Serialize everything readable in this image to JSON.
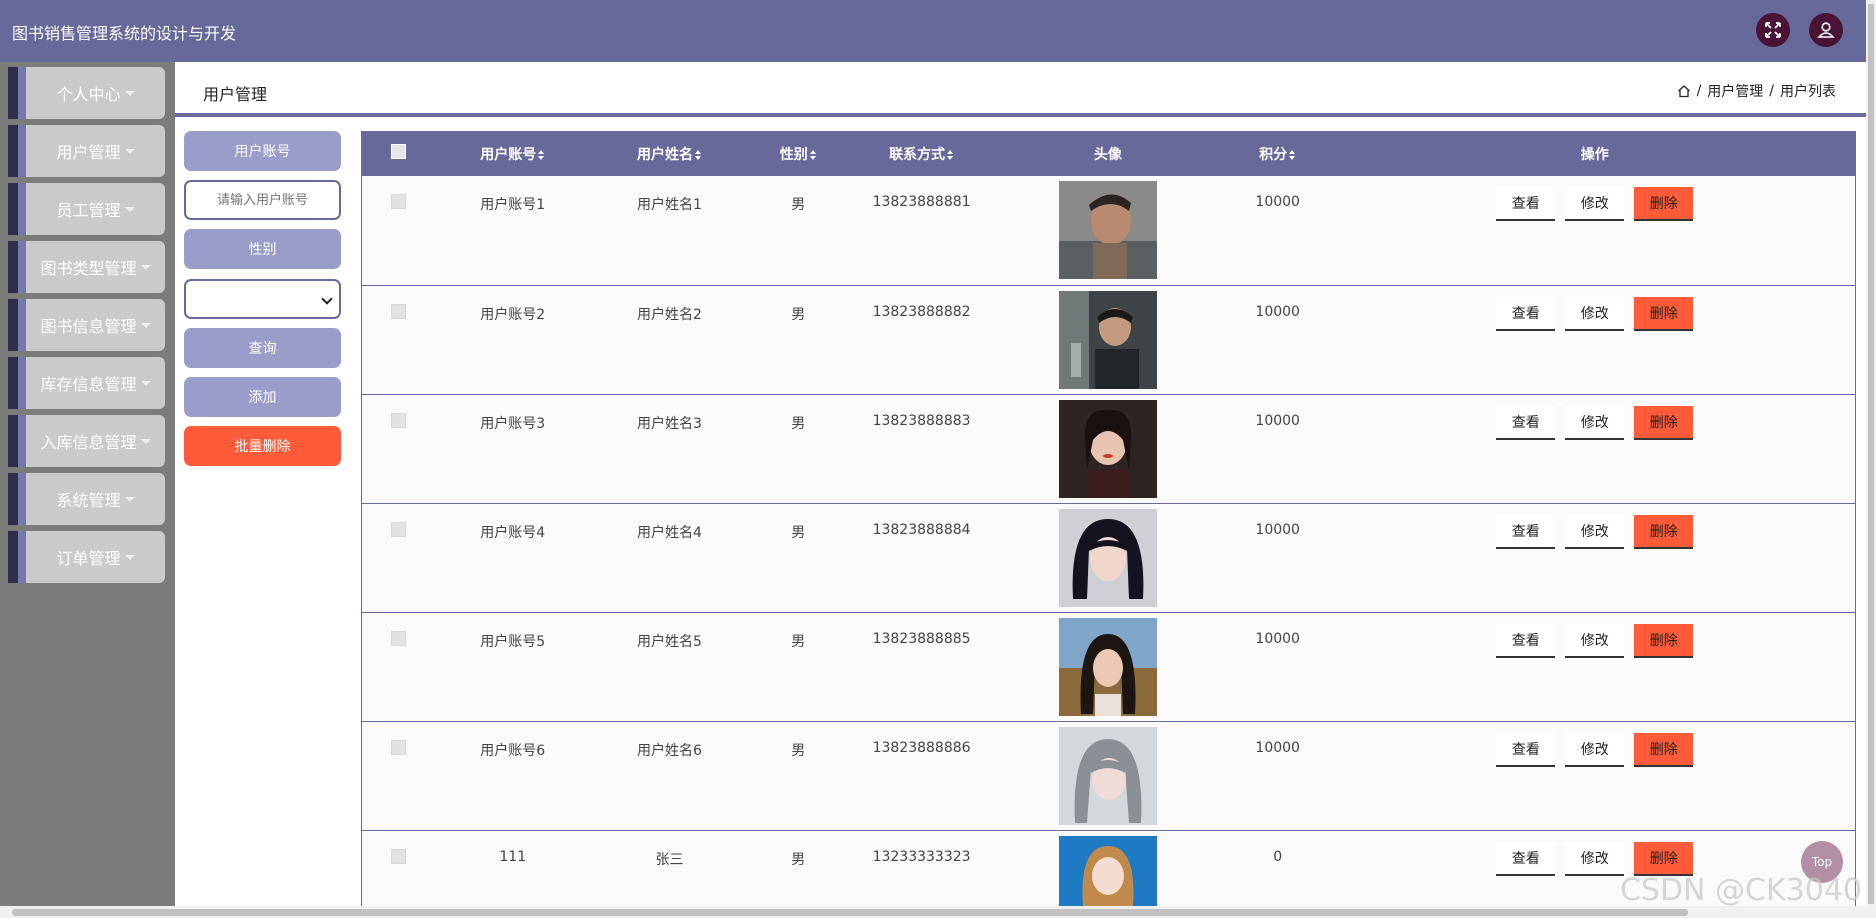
{
  "header": {
    "title": "图书销售管理系统的设计与开发",
    "icons": [
      "fullscreen-icon",
      "user-icon"
    ]
  },
  "sidebar": {
    "items": [
      {
        "label": "个人中心"
      },
      {
        "label": "用户管理"
      },
      {
        "label": "员工管理"
      },
      {
        "label": "图书类型管理"
      },
      {
        "label": "图书信息管理"
      },
      {
        "label": "库存信息管理"
      },
      {
        "label": "入库信息管理"
      },
      {
        "label": "系统管理"
      },
      {
        "label": "订单管理"
      }
    ]
  },
  "page": {
    "title": "用户管理",
    "breadcrumb": [
      "用户管理",
      "用户列表"
    ],
    "breadcrumb_sep": "/"
  },
  "search": {
    "account_label": "用户账号",
    "account_placeholder": "请输入用户账号",
    "gender_label": "性别",
    "gender_value": "",
    "query_label": "查询",
    "add_label": "添加",
    "batch_delete_label": "批量删除"
  },
  "table": {
    "headers": [
      "用户账号",
      "用户姓名",
      "性别",
      "联系方式",
      "头像",
      "积分",
      "操作"
    ],
    "rows": [
      {
        "account": "用户账号1",
        "name": "用户姓名1",
        "gender": "男",
        "phone": "13823888881",
        "points": "10000"
      },
      {
        "account": "用户账号2",
        "name": "用户姓名2",
        "gender": "男",
        "phone": "13823888882",
        "points": "10000"
      },
      {
        "account": "用户账号3",
        "name": "用户姓名3",
        "gender": "男",
        "phone": "13823888883",
        "points": "10000"
      },
      {
        "account": "用户账号4",
        "name": "用户姓名4",
        "gender": "男",
        "phone": "13823888884",
        "points": "10000"
      },
      {
        "account": "用户账号5",
        "name": "用户姓名5",
        "gender": "男",
        "phone": "13823888885",
        "points": "10000"
      },
      {
        "account": "用户账号6",
        "name": "用户姓名6",
        "gender": "男",
        "phone": "13823888886",
        "points": "10000"
      },
      {
        "account": "111",
        "name": "张三",
        "gender": "男",
        "phone": "13233333323",
        "points": "0"
      }
    ],
    "actions": {
      "view": "查看",
      "edit": "修改",
      "delete": "删除"
    }
  },
  "top_button": "Top",
  "watermark": "CSDN @CK3040",
  "colors": {
    "primary": "#67699a",
    "button": "#9a9dca",
    "danger": "#fe5b3a",
    "sidebar_bg": "#7b7d7a",
    "sidebar_item": "#c9cac9"
  }
}
